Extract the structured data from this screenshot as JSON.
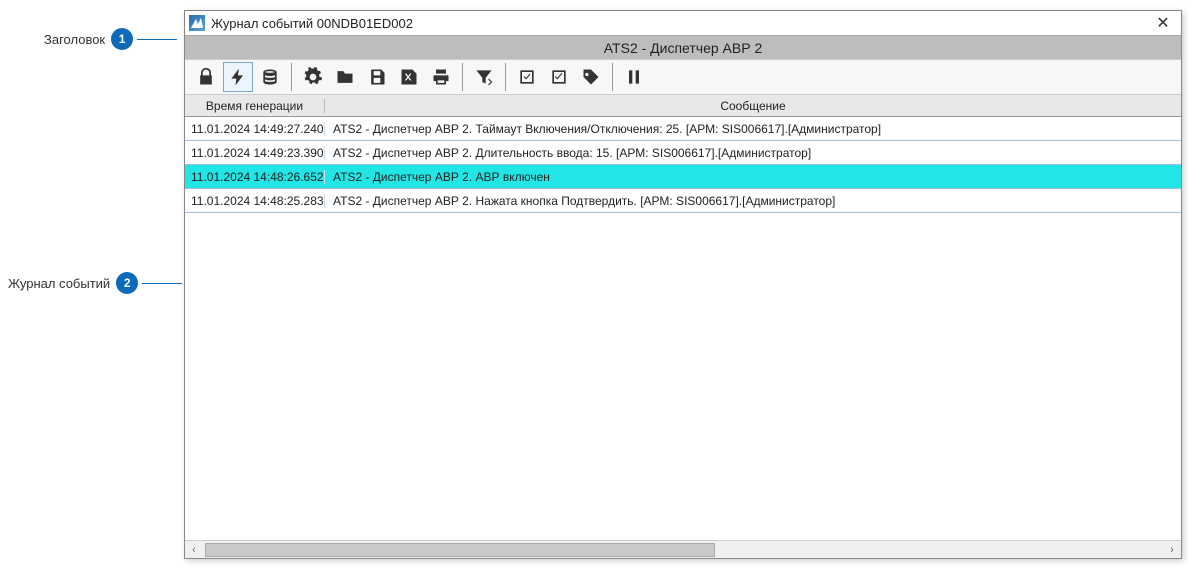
{
  "annotations": {
    "header_label": "Заголовок",
    "header_num": "1",
    "log_label": "Журнал событий",
    "log_num": "2"
  },
  "window": {
    "title": "Журнал событий 00NDB01ED002",
    "close": "✕"
  },
  "header": {
    "text": "ATS2 - Диспетчер АВР 2"
  },
  "columns": {
    "time": "Время генерации",
    "msg": "Сообщение"
  },
  "rows": [
    {
      "time": "11.01.2024 14:49:27.240",
      "msg": "ATS2 - Диспетчер АВР 2. Таймаут Включения/Отключения: 25. [АРМ: SIS006617].[Администратор]",
      "hl": false
    },
    {
      "time": "11.01.2024 14:49:23.390",
      "msg": "ATS2 - Диспетчер АВР 2. Длительность ввода: 15. [АРМ: SIS006617].[Администратор]",
      "hl": false
    },
    {
      "time": "11.01.2024 14:48:26.652",
      "msg": "ATS2 - Диспетчер АВР 2. АВР включен",
      "hl": true
    },
    {
      "time": "11.01.2024 14:48:25.283",
      "msg": "ATS2 - Диспетчер АВР 2. Нажата кнопка Подтвердить. [АРМ: SIS006617].[Администратор]",
      "hl": false
    }
  ],
  "toolbar": {
    "lock": "lock-icon",
    "bolt": "bolt-icon",
    "db": "db-icon",
    "gear": "gear-icon",
    "folder": "folder-icon",
    "save": "save-icon",
    "excel": "excel-icon",
    "print": "print-icon",
    "filter": "filter-icon",
    "check1": "check-icon",
    "check2": "check-double-icon",
    "tag": "tag-icon",
    "pause": "pause-icon"
  },
  "scroll": {
    "left": "‹",
    "right": "›"
  }
}
